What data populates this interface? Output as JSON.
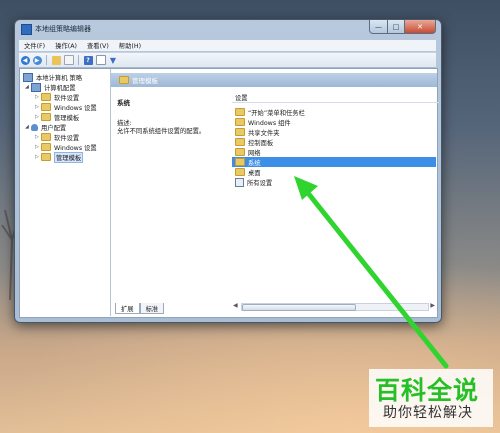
{
  "window": {
    "title": "本地组策略编辑器",
    "controls": {
      "minimize": "—",
      "maximize": "□",
      "close": "✕"
    }
  },
  "menu": [
    "文件(F)",
    "操作(A)",
    "查看(V)",
    "帮助(H)"
  ],
  "toolbar": {
    "icons": [
      "back-arrow-icon",
      "forward-arrow-icon",
      "up-folder-icon",
      "show-hide-tree-icon",
      "export-list-icon",
      "help-icon",
      "properties-icon",
      "filter-icon"
    ]
  },
  "tree": {
    "root": "本地计算机 策略",
    "computer_config": "计算机配置",
    "computer_children": [
      "软件设置",
      "Windows 设置",
      "管理模板"
    ],
    "user_config": "用户配置",
    "user_children": [
      "软件设置",
      "Windows 设置",
      "管理模板"
    ]
  },
  "header": {
    "title": "管理模板"
  },
  "description": {
    "title": "系统",
    "label": "描述:",
    "text": "允许不同系统组件设置的配置。"
  },
  "list": {
    "column": "设置",
    "items": [
      "“开始”菜单和任务栏",
      "Windows 组件",
      "共享文件夹",
      "控制面板",
      "网络",
      "系统",
      "桌面",
      "所有设置"
    ],
    "selected": "系统"
  },
  "tabs": [
    "扩展",
    "标准"
  ],
  "watermark": {
    "main": "百科全说",
    "sub": "助你轻松解决"
  },
  "colors": {
    "arrow": "#2fd42f",
    "selection": "#3c8ee7",
    "watermark_green": "#25c025"
  }
}
